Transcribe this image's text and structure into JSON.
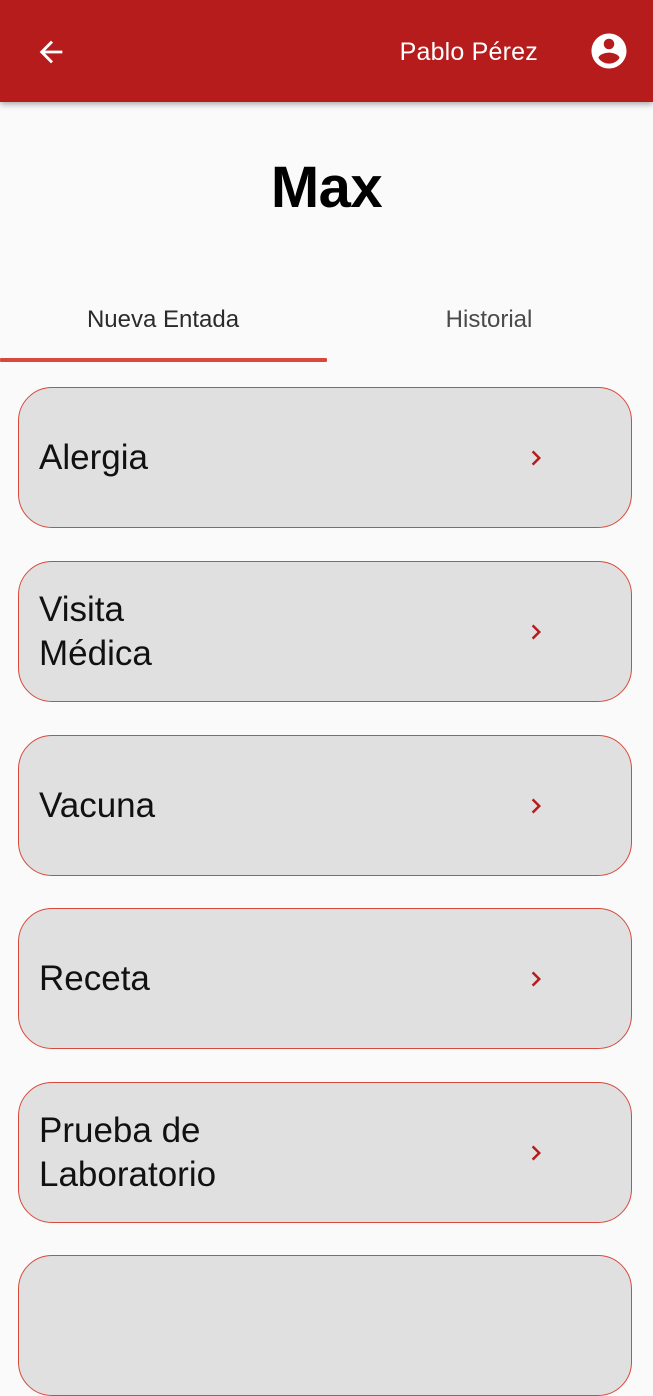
{
  "appbar": {
    "back_icon": "arrow-left-icon",
    "user_name": "Pablo Pérez",
    "account_icon": "account-circle-icon",
    "background_color": "#b71c1c"
  },
  "pet": {
    "name": "Max"
  },
  "tabs": [
    {
      "label": "Nueva Entada",
      "selected": true
    },
    {
      "label": "Historial",
      "selected": false
    }
  ],
  "entry_types": [
    {
      "label": "Alergia",
      "icon": "chevron-right-icon"
    },
    {
      "label": "Visita Médica",
      "icon": "chevron-right-icon"
    },
    {
      "label": "Vacuna",
      "icon": "chevron-right-icon"
    },
    {
      "label": "Receta",
      "icon": "chevron-right-icon"
    },
    {
      "label": "Prueba de Laboratorio",
      "icon": "chevron-right-icon"
    },
    {
      "label": "",
      "icon": "chevron-right-icon"
    }
  ],
  "colors": {
    "accent": "#d9493b",
    "card_background": "#e0e0e0",
    "chevron": "#b71c1c"
  }
}
